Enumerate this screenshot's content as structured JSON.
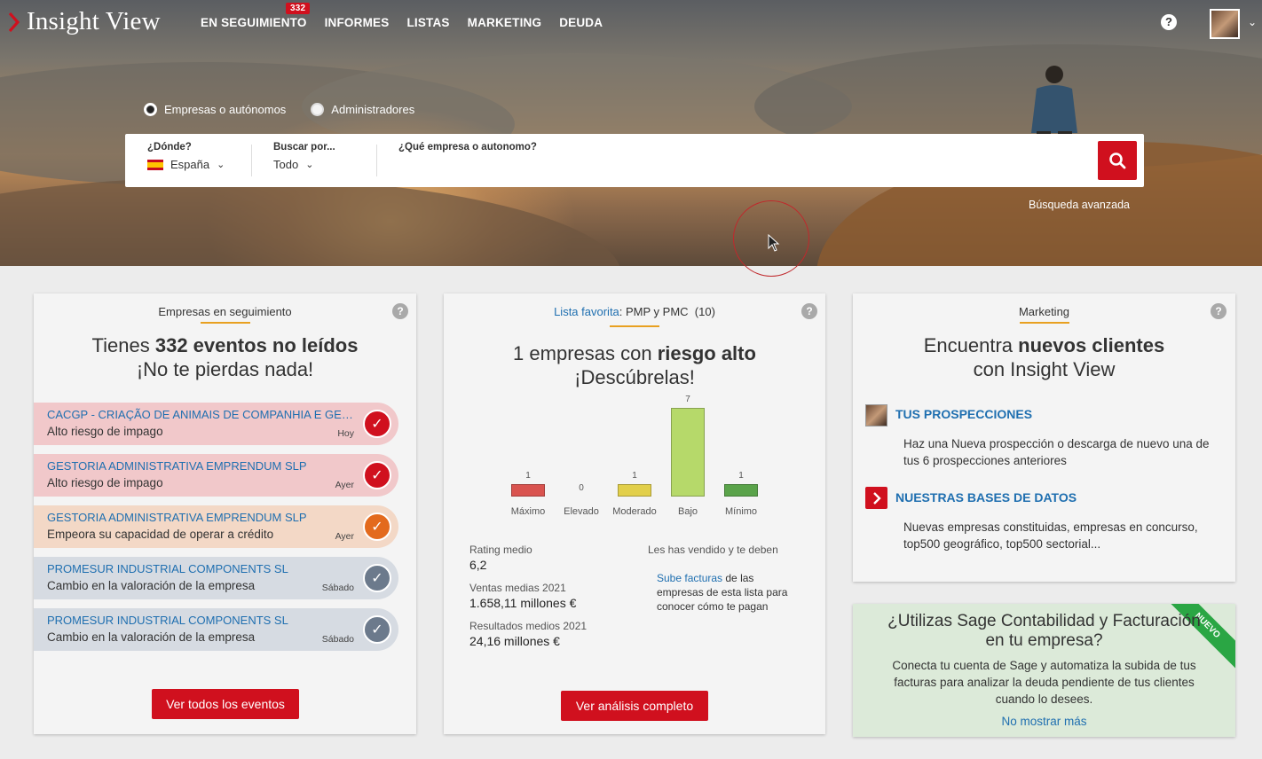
{
  "app": {
    "title": "Insight View"
  },
  "nav": {
    "items": [
      "EN SEGUIMIENTO",
      "INFORMES",
      "LISTAS",
      "MARKETING",
      "DEUDA"
    ],
    "badge": "332",
    "help_glyph": "?"
  },
  "search": {
    "radios": [
      {
        "label": "Empresas o autónomos",
        "selected": true
      },
      {
        "label": "Administradores",
        "selected": false
      }
    ],
    "where_label": "¿Dónde?",
    "where_value": "España",
    "by_label": "Buscar por...",
    "by_value": "Todo",
    "query_label": "¿Qué empresa o autonomo?",
    "query_value": "",
    "advanced": "Búsqueda avanzada"
  },
  "tracking": {
    "header": "Empresas en seguimiento",
    "title_pre": "Tienes ",
    "title_bold": "332 eventos no leídos",
    "title_line2": "¡No te pierdas nada!",
    "events": [
      {
        "name": "CACGP - CRIAÇÃO DE ANIMAIS DE COMPANHIA E GESTÃO",
        "desc": "Alto riesgo de impago",
        "when": "Hoy",
        "level": "high"
      },
      {
        "name": "GESTORIA ADMINISTRATIVA EMPRENDUM SLP",
        "desc": "Alto riesgo de impago",
        "when": "Ayer",
        "level": "high"
      },
      {
        "name": "GESTORIA ADMINISTRATIVA EMPRENDUM SLP",
        "desc": "Empeora su capacidad de operar a crédito",
        "when": "Ayer",
        "level": "medium"
      },
      {
        "name": "PROMESUR INDUSTRIAL COMPONENTS SL",
        "desc": "Cambio en la valoración de la empresa",
        "when": "Sábado",
        "level": "info"
      },
      {
        "name": "PROMESUR INDUSTRIAL COMPONENTS SL",
        "desc": "Cambio en la valoración de la empresa",
        "when": "Sábado",
        "level": "info"
      }
    ],
    "button": "Ver todos los eventos"
  },
  "favorites": {
    "link": "Lista favorita",
    "list_name": ": PMP y PMC",
    "count": "(10)",
    "title_pre": "1 empresas con ",
    "title_bold": "riesgo alto",
    "title_line2": "¡Descúbrelas!",
    "chart_data": {
      "type": "bar",
      "categories": [
        "Máximo",
        "Elevado",
        "Moderado",
        "Bajo",
        "Mínimo"
      ],
      "values": [
        1,
        0,
        1,
        7,
        1
      ],
      "colors": [
        "#d9534f",
        "#cccccc",
        "#e2cf4a",
        "#b6d96a",
        "#5aa34a"
      ]
    },
    "stats": [
      {
        "label": "Rating medio",
        "value": "6,2"
      },
      {
        "label": "Ventas medias 2021",
        "value": "1.658,11 millones €"
      },
      {
        "label": "Resultados medios 2021",
        "value": "24,16 millones €"
      }
    ],
    "debt_title": "Les has vendido y te deben",
    "debt_link": "Sube facturas",
    "debt_rest1": " de las",
    "debt_rest2": "empresas de esta lista para",
    "debt_rest3": "conocer cómo te pagan",
    "button": "Ver análisis completo"
  },
  "marketing": {
    "header": "Marketing",
    "title_pre": "Encuentra ",
    "title_bold": "nuevos clientes",
    "title_line2": "con Insight View",
    "items": [
      {
        "title": "TUS PROSPECCIONES",
        "text": "Haz una Nueva prospección o descarga de nuevo una de tus 6 prospecciones anteriores"
      },
      {
        "title": "NUESTRAS BASES DE DATOS",
        "text": "Nuevas empresas constituidas, empresas en concurso, top500 geográfico, top500 sectorial..."
      }
    ]
  },
  "sage": {
    "title": "¿Utilizas Sage Contabilidad y Facturación en tu empresa?",
    "text": "Conecta tu cuenta de Sage y automatiza la subida de tus facturas para analizar la deuda pendiente de tus clientes cuando lo desees.",
    "link": "No mostrar más",
    "ribbon": "NUEVO"
  },
  "colors": {
    "accent": "#d0101e",
    "link": "#1f6fb0",
    "underline": "#e8a020"
  }
}
